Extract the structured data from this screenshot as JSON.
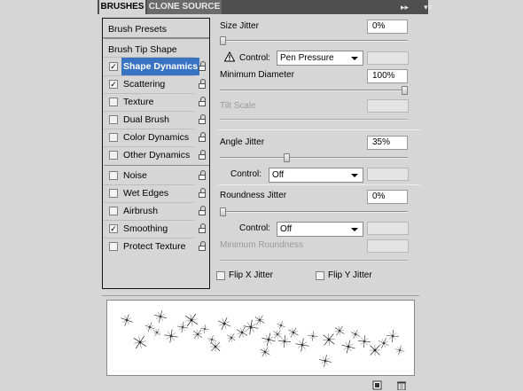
{
  "tabs": {
    "brushes": "BRUSHES",
    "clone_source": "CLONE SOURCE"
  },
  "panel_icons": {
    "collapse": "▸▸",
    "menu": "▾≡"
  },
  "left": {
    "brush_presets": "Brush Presets",
    "brush_tip_shape": "Brush Tip Shape",
    "items": [
      {
        "label": "Shape Dynamics",
        "checked": true,
        "selected": true
      },
      {
        "label": "Scattering",
        "checked": true
      },
      {
        "label": "Texture",
        "checked": false
      },
      {
        "label": "Dual Brush",
        "checked": false
      },
      {
        "label": "Color Dynamics",
        "checked": false
      },
      {
        "label": "Other Dynamics",
        "checked": false
      },
      {
        "label": "Noise",
        "checked": false
      },
      {
        "label": "Wet Edges",
        "checked": false
      },
      {
        "label": "Airbrush",
        "checked": false
      },
      {
        "label": "Smoothing",
        "checked": true
      },
      {
        "label": "Protect Texture",
        "checked": false
      }
    ]
  },
  "settings": {
    "size_jitter": {
      "label": "Size Jitter",
      "value": "0%",
      "level": 0
    },
    "size_control": {
      "label": "Control:",
      "value": "Pen Pressure"
    },
    "minimum_diameter": {
      "label": "Minimum Diameter",
      "value": "100%",
      "level": 1.0
    },
    "tilt_scale": {
      "label": "Tilt Scale"
    },
    "angle_jitter": {
      "label": "Angle Jitter",
      "value": "35%",
      "level": 0.35
    },
    "angle_control": {
      "label": "Control:",
      "value": "Off"
    },
    "roundness_jitter": {
      "label": "Roundness Jitter",
      "value": "0%",
      "level": 0
    },
    "roundness_control": {
      "label": "Control:",
      "value": "Off"
    },
    "minimum_roundness": {
      "label": "Minimum Roundness"
    },
    "flip_x": {
      "label": "Flip X Jitter",
      "checked": false
    },
    "flip_y": {
      "label": "Flip Y Jitter",
      "checked": false
    }
  },
  "colors": {
    "selection": "#3973c4",
    "tab_bar": "#4f4f4f",
    "panel": "#d6d6d6"
  }
}
